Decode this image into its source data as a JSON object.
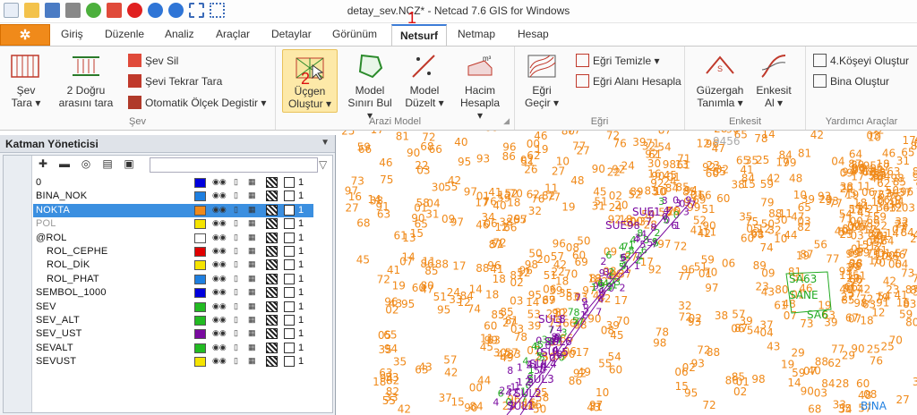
{
  "window": {
    "title": "detay_sev.NCZ* - Netcad 7.6 GIS for Windows"
  },
  "annotations": {
    "one": "1",
    "two": "2"
  },
  "quick_access": [
    "new-icon",
    "open-icon",
    "save-icon",
    "print-icon",
    "help-icon",
    "close-icon",
    "info-icon",
    "undo-icon",
    "redo-icon",
    "select-icon",
    "zoom-window-icon",
    "dropdown-icon"
  ],
  "tabs": [
    "Giriş",
    "Düzenle",
    "Analiz",
    "Araçlar",
    "Detaylar",
    "Görünüm",
    "Netsurf",
    "Netmap",
    "Hesap"
  ],
  "active_tab": "Netsurf",
  "ribbon": {
    "sev": {
      "label": "Şev",
      "tara": "Şev\nTara ▾",
      "dogru": "2 Doğru\narasını tara",
      "sil": "Şev Sil",
      "tekrar": "Şevi Tekrar Tara",
      "otomatik": "Otomatik Ölçek Degistir ▾"
    },
    "arazi": {
      "label": "Arazi Model",
      "ucgen": "Üçgen\nOluştur ▾",
      "sinir": "Model\nSınırı Bul ▾",
      "duzelt": "Model\nDüzelt ▾",
      "hacim": "Hacim\nHesapla ▾"
    },
    "egri": {
      "label": "Eğri",
      "gecir": "Eğri\nGeçir ▾",
      "temizle": "Eğri Temizle ▾",
      "alan": "Eğri Alanı Hesapla"
    },
    "enkesit": {
      "label": "Enkesit",
      "guzergah": "Güzergah\nTanımla ▾",
      "al": "Enkesit\nAl ▾"
    },
    "yardimci": {
      "label": "Yardımcı Araçlar",
      "kose": "4.Köşeyi Oluştur",
      "bina": "Bina Oluştur"
    }
  },
  "layer_manager": {
    "title": "Katman Yöneticisi",
    "filter_value": "",
    "layers": [
      {
        "name": "0",
        "color": "#0000dd",
        "count": "1",
        "indent": false,
        "selected": false,
        "off": false
      },
      {
        "name": "BINA_NOK",
        "color": "#1e7fe0",
        "count": "1",
        "indent": false,
        "selected": false,
        "off": false
      },
      {
        "name": "NOKTA",
        "color": "#f08a1a",
        "count": "1",
        "indent": false,
        "selected": true,
        "off": false
      },
      {
        "name": "POL",
        "color": "#f5e400",
        "count": "1",
        "indent": false,
        "selected": false,
        "off": true
      },
      {
        "name": "@ROL",
        "color": "#ffffff",
        "count": "1",
        "indent": false,
        "selected": false,
        "off": false
      },
      {
        "name": "ROL_CEPHE",
        "color": "#e00000",
        "count": "1",
        "indent": true,
        "selected": false,
        "off": false
      },
      {
        "name": "ROL_DİK",
        "color": "#f5e400",
        "count": "1",
        "indent": true,
        "selected": false,
        "off": false
      },
      {
        "name": "ROL_PHAT",
        "color": "#1e7fe0",
        "count": "1",
        "indent": true,
        "selected": false,
        "off": false
      },
      {
        "name": "SEMBOL_1000",
        "color": "#0000dd",
        "count": "1",
        "indent": false,
        "selected": false,
        "off": false
      },
      {
        "name": "SEV",
        "color": "#22bb22",
        "count": "1",
        "indent": false,
        "selected": false,
        "off": false
      },
      {
        "name": "SEV_ALT",
        "color": "#22bb22",
        "count": "1",
        "indent": false,
        "selected": false,
        "off": false
      },
      {
        "name": "SEV_UST",
        "color": "#7a0aa0",
        "count": "1",
        "indent": false,
        "selected": false,
        "off": false
      },
      {
        "name": "SEVALT",
        "color": "#22bb22",
        "count": "1",
        "indent": false,
        "selected": false,
        "off": false
      },
      {
        "name": "SEVUST",
        "color": "#f5e400",
        "count": "1",
        "indent": false,
        "selected": false,
        "off": false
      }
    ]
  },
  "map": {
    "labels": [
      "9456",
      "SUE1",
      "SUE9",
      "SUL8",
      "SUL6",
      "SUL5",
      "SUL4",
      "SUL3",
      "SUL2",
      "SUL1",
      "SA63",
      "SANE",
      "SA6",
      "BINA"
    ]
  },
  "colors": {
    "accent": "#3c7cd7",
    "file_tab": "#f08a1a",
    "point_orange": "#f08a1a",
    "slope_purple": "#7a0aa0",
    "slope_green": "#22aa22",
    "selection": "#3b8fe0"
  }
}
